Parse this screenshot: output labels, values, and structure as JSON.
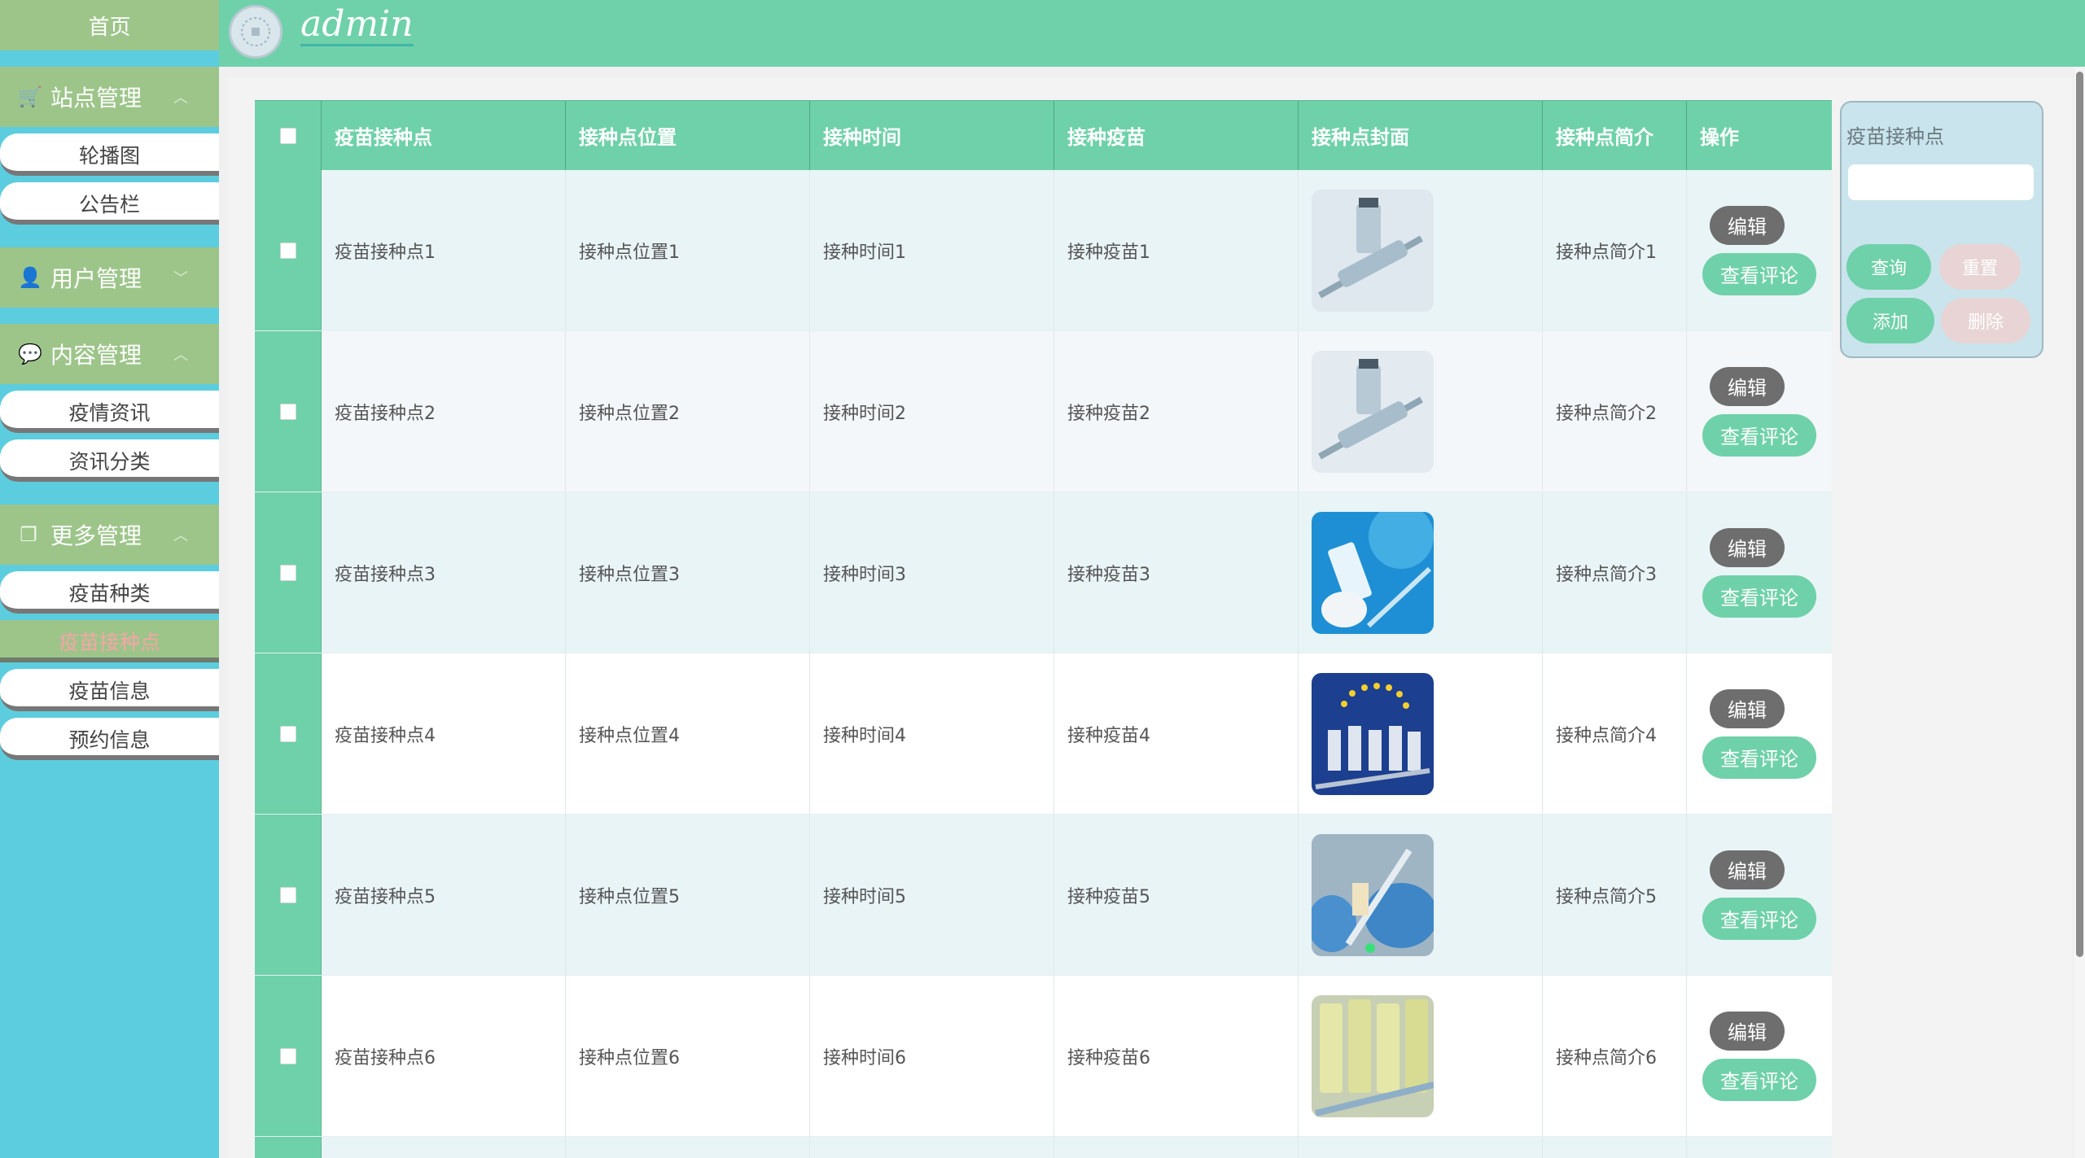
{
  "sidebar": {
    "home": "首页",
    "groups": [
      {
        "title": "站点管理",
        "icon": "cart-icon",
        "items": [
          "轮播图",
          "公告栏"
        ]
      },
      {
        "title": "用户管理",
        "icon": "user-icon",
        "items": []
      },
      {
        "title": "内容管理",
        "icon": "chat-icon",
        "items": [
          "疫情资讯",
          "资讯分类"
        ]
      },
      {
        "title": "更多管理",
        "icon": "copy-icon",
        "items": [
          "疫苗种类",
          "疫苗接种点",
          "疫苗信息",
          "预约信息"
        ]
      }
    ],
    "active_item": "疫苗接种点"
  },
  "header": {
    "user": "admin"
  },
  "table": {
    "columns": [
      "疫苗接种点",
      "接种点位置",
      "接种时间",
      "接种疫苗",
      "接种点封面",
      "接种点简介",
      "操作"
    ],
    "rows": [
      {
        "name": "疫苗接种点1",
        "location": "接种点位置1",
        "time": "接种时间1",
        "vaccine": "接种疫苗1",
        "intro": "接种点简介1"
      },
      {
        "name": "疫苗接种点2",
        "location": "接种点位置2",
        "time": "接种时间2",
        "vaccine": "接种疫苗2",
        "intro": "接种点简介2"
      },
      {
        "name": "疫苗接种点3",
        "location": "接种点位置3",
        "time": "接种时间3",
        "vaccine": "接种疫苗3",
        "intro": "接种点简介3"
      },
      {
        "name": "疫苗接种点4",
        "location": "接种点位置4",
        "time": "接种时间4",
        "vaccine": "接种疫苗4",
        "intro": "接种点简介4"
      },
      {
        "name": "疫苗接种点5",
        "location": "接种点位置5",
        "time": "接种时间5",
        "vaccine": "接种疫苗5",
        "intro": "接种点简介5"
      },
      {
        "name": "疫苗接种点6",
        "location": "接种点位置6",
        "time": "接种时间6",
        "vaccine": "接种疫苗6",
        "intro": "接种点简介6"
      }
    ],
    "edit_label": "编辑",
    "review_label": "查看评论"
  },
  "search": {
    "label": "疫苗接种点",
    "value": "",
    "query_label": "查询",
    "reset_label": "重置",
    "add_label": "添加",
    "delete_label": "删除"
  },
  "colors": {
    "accent": "#6fd1a9",
    "sidebar_bg": "#5ccdde",
    "sidebar_head": "#9dc58a",
    "edit_button": "#6e6e6e",
    "active_text": "#f4a6a6"
  }
}
